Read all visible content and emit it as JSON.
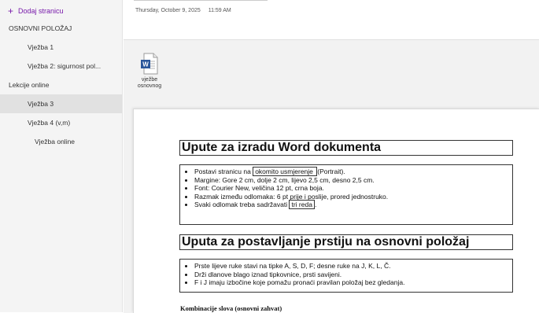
{
  "sidebar": {
    "add_page_label": "Dodaj stranicu",
    "pages": [
      {
        "label": "OSNOVNI POLOŽAJ",
        "level": 0,
        "selected": false
      },
      {
        "label": "Vježba 1",
        "level": 1,
        "selected": false
      },
      {
        "label": "Vježba 2: sigurnost pol...",
        "level": 1,
        "selected": false
      },
      {
        "label": "Lekcije online",
        "level": 0,
        "selected": false
      },
      {
        "label": "Vježba 3",
        "level": 1,
        "selected": true
      },
      {
        "label": "Vježba 4 (v,m)",
        "level": 1,
        "selected": false
      },
      {
        "label": "Vježba online",
        "level": 2,
        "selected": false
      }
    ]
  },
  "header": {
    "date": "Thursday, October 9, 2025",
    "time": "11:59 AM"
  },
  "attachment": {
    "icon": "word-document-icon",
    "name": "vježbe\nosnovnog"
  },
  "document": {
    "heading1": "Upute za izradu Word dokumenta",
    "list1": {
      "item1_prefix": "Postavi stranicu na ",
      "item1_boxed": "okomito usmjerenje ",
      "item1_suffix": " (Portrait).",
      "item2": "Margine: Gore 2 cm, dolje 2 cm, lijevo 2,5 cm, desno 2,5 cm.",
      "item3": "Font: Courier New, veličina 12 pt, crna boja.",
      "item4": "Razmak između odlomaka: 6 pt prije i poslije, prored jednostruko.",
      "item5_prefix": "Svaki odlomak treba sadržavati ",
      "item5_boxed": "tri reda",
      "item5_suffix": "."
    },
    "heading2": "Uputa za postavljanje prstiju na osnovni položaj",
    "list2": [
      "Prste lijeve ruke stavi na tipke A, S, D, F; desne ruke na J, K, L, Č.",
      "Drži dlanove blago iznad tipkovnice, prsti savijeni.",
      "F i J imaju izbočine koje pomažu pronaći pravilan položaj bez gledanja."
    ],
    "subheading": "Kombinacije slova (osnovni zahvat)"
  },
  "colors": {
    "accent": "#7719aa",
    "word_blue": "#2b579a",
    "selected_bg": "#e1e1e1"
  }
}
